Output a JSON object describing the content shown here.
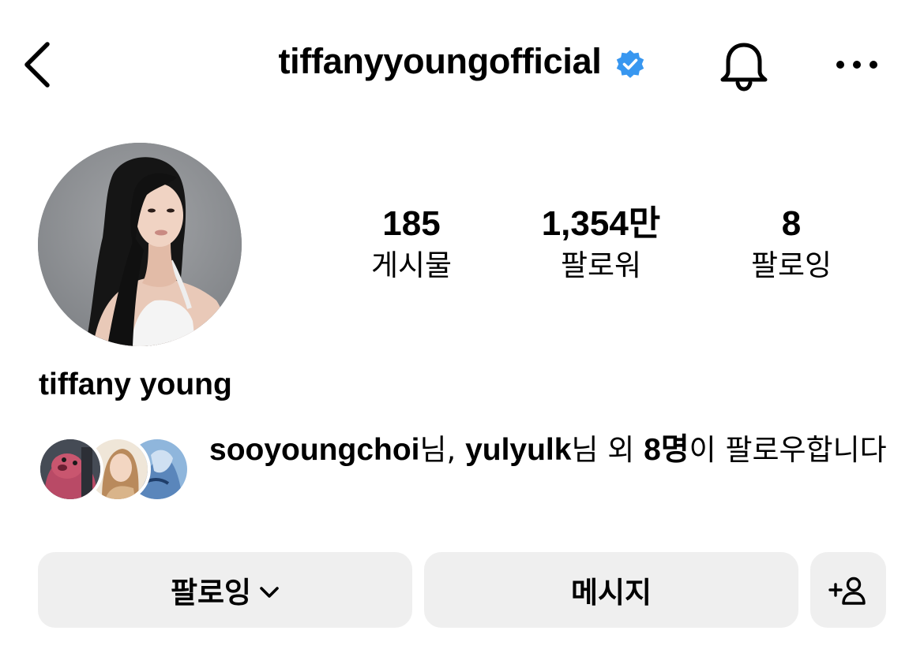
{
  "header": {
    "username": "tiffanyyoungofficial",
    "verified_color": "#3897f0",
    "back_icon": "chevron-left-icon",
    "bell_icon": "bell-icon",
    "more_icon": "more-horizontal-icon"
  },
  "profile": {
    "display_name": "tiffany young",
    "stats": {
      "posts_value": "185",
      "posts_label": "게시물",
      "followers_value": "1,354만",
      "followers_label": "팔로워",
      "following_value": "8",
      "following_label": "팔로잉"
    }
  },
  "mutual": {
    "user1": "sooyoungchoi",
    "suffix1": "님, ",
    "user2": "yulyulk",
    "suffix2": "님 외 ",
    "count": "8명",
    "suffix3": "이 팔로우합니다"
  },
  "actions": {
    "following_label": "팔로잉",
    "message_label": "메시지",
    "add_user_icon": "add-person-icon"
  },
  "colors": {
    "button_bg": "#efefef",
    "accent_blue": "#3897f0"
  }
}
